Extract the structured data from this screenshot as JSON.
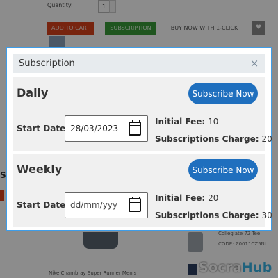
{
  "background": {
    "quantity_label": "Quantity:",
    "quantity_value": "1",
    "add_to_cart": "ADD TO CART",
    "subscription_button": "SUBSCRIPTION",
    "buy_now": "BUY NOW WITH 1-CLICK",
    "side_letter": "S",
    "product_title": "Nike Chambray Super Runner Men's",
    "tee_name": "Collegiate 72 Tee",
    "tee_code": "CODE:  Z0011CZ5NI",
    "logo_part1": "Socra",
    "logo_part2": "Hub"
  },
  "modal": {
    "title": "Subscription",
    "close_symbol": "×",
    "plans": [
      {
        "name": "Daily",
        "button_label": "Subscribe Now",
        "start_label": "Start Date",
        "start_date": "28/03/2023",
        "initial_fee_label": "Initial Fee:",
        "initial_fee": "10",
        "charge_label": "Subscriptions Charge:",
        "charge": "20"
      },
      {
        "name": "Weekly",
        "button_label": "Subscribe Now",
        "start_label": "Start Date",
        "start_date": "dd/mm/yyy",
        "initial_fee_label": "Initial Fee:",
        "initial_fee": "20",
        "charge_label": "Subscriptions Charge:",
        "charge": "30"
      }
    ]
  },
  "colors": {
    "modal_border": "#3d9de9",
    "button_blue": "#1f6fbe",
    "add_to_cart": "#d9421c",
    "subscription": "#3a9b3a"
  },
  "icons": {
    "close": "close-icon",
    "calendar": "calendar-icon",
    "heart": "heart-icon"
  }
}
